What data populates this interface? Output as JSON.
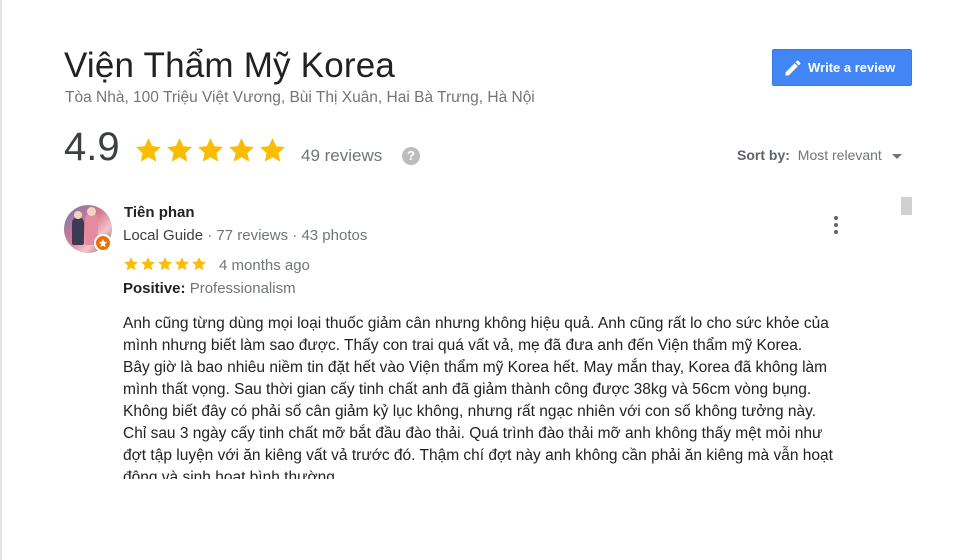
{
  "place": {
    "name": "Viện Thẩm Mỹ Korea",
    "address": "Tòa Nhà, 100 Triệu Việt Vương, Bùi Thị Xuân, Hai Bà Trưng, Hà Nội"
  },
  "actions": {
    "write_review_label": "Write a review",
    "write_review_icon": "pencil-icon"
  },
  "summary": {
    "rating": "4.9",
    "stars_filled": 5,
    "stars_total": 5,
    "review_count": "49 reviews",
    "help_glyph": "?"
  },
  "sort": {
    "label": "Sort by:",
    "value": "Most relevant"
  },
  "review": {
    "author": "Tiên phan",
    "badge": "Local Guide",
    "sep1": "·",
    "reviews": "77 reviews",
    "sep2": "·",
    "photos": "43 photos",
    "stars": 5,
    "time": "4 months ago",
    "positive_label": "Positive:",
    "positive_value": "Professionalism",
    "body_lines": [
      "Anh cũng từng dùng mọi loại thuốc giảm cân nhưng không hiệu quả. Anh cũng rất lo cho sức khỏe của",
      "mình nhưng biết làm sao được. Thấy con trai quá vất vả, mẹ đã đưa anh đến Viện thẩm mỹ Korea.",
      "Bây giờ là bao nhiêu niềm tin đặt hết vào Viện thẩm mỹ Korea hết. May mắn thay, Korea đã không làm",
      "mình thất vọng. Sau thời gian cấy tinh chất anh đã giảm thành công được 38kg và 56cm vòng bụng.",
      "Không biết đây có phải số cân giảm kỷ lục không, nhưng rất ngạc nhiên với con số không tưởng này.",
      "Chỉ sau 3 ngày cấy tinh chất mỡ bắt đầu đào thải. Quá trình đào thải mỡ anh không thấy mệt mỏi như",
      "đợt tập luyện với ăn kiêng vất vả trước đó. Thậm chí đợt này anh không cần phải ăn kiêng mà vẫn hoạt",
      "động và sinh hoạt bình thường."
    ]
  },
  "colors": {
    "accent": "#4285f4",
    "star": "#fbbc04",
    "muted_text": "#70757a",
    "badge": "#e8710a"
  }
}
